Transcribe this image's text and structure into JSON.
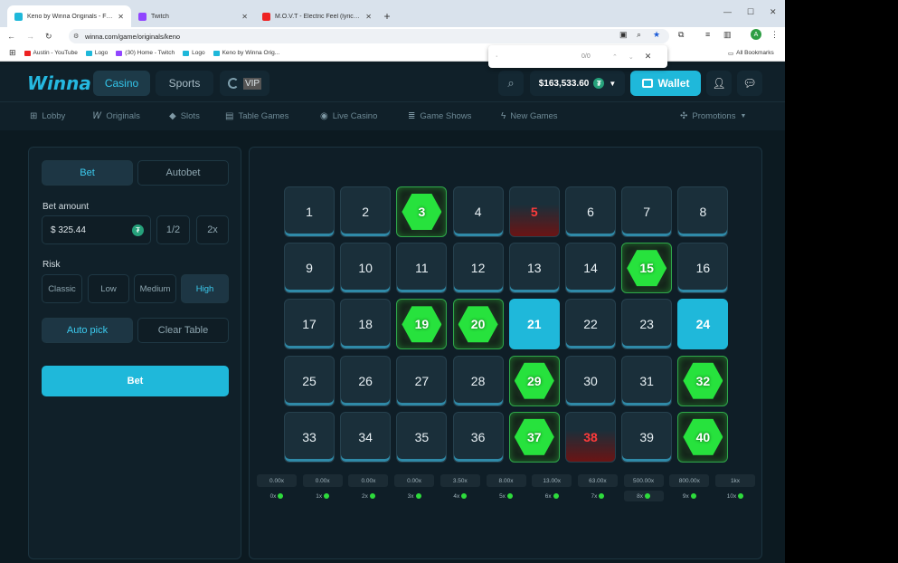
{
  "browser": {
    "tabs": [
      {
        "title": "Keno by Winna Originals - Fast",
        "color": "#1fb8da",
        "active": true
      },
      {
        "title": "Twitch",
        "color": "#9146ff",
        "active": false
      },
      {
        "title": "M.O.V.T - Electric Feel (lyrics) · ",
        "color": "#e22",
        "active": false
      }
    ],
    "url": "winna.com/game/originals/keno",
    "bookmarks": [
      "Austin - YouTube",
      "Logo",
      "(30) Home - Twitch",
      "Logo",
      "Keno by Winna Orig..."
    ],
    "all_bookmarks": "All Bookmarks",
    "find": {
      "value": "·",
      "count": "0/0"
    },
    "profile": "A"
  },
  "header": {
    "logo": "Winna",
    "casino": "Casino",
    "sports": "Sports",
    "vip": "VIP",
    "balance": "$163,533.60",
    "wallet": "Wallet"
  },
  "nav": {
    "items": [
      {
        "label": "Lobby",
        "icon": "grid-icon"
      },
      {
        "label": "Originals",
        "icon": "winna-w-icon"
      },
      {
        "label": "Slots",
        "icon": "diamond-icon"
      },
      {
        "label": "Table Games",
        "icon": "cards-icon"
      },
      {
        "label": "Live Casino",
        "icon": "live-signal-icon"
      },
      {
        "label": "Game Shows",
        "icon": "stack-icon"
      },
      {
        "label": "New Games",
        "icon": "lightning-icon"
      }
    ],
    "promotions": "Promotions"
  },
  "panel": {
    "tab_bet": "Bet",
    "tab_autobet": "Autobet",
    "bet_amount_label": "Bet amount",
    "bet_amount": "$  325.44",
    "half": "1/2",
    "double": "2x",
    "risk_label": "Risk",
    "risks": [
      "Classic",
      "Low",
      "Medium",
      "High"
    ],
    "selected_risk": "High",
    "auto_pick": "Auto pick",
    "clear_table": "Clear Table",
    "bet_button": "Bet"
  },
  "board": {
    "hits": [
      3,
      15,
      19,
      20,
      29,
      32,
      37,
      40
    ],
    "misses": [
      5,
      38
    ],
    "selected": [
      21,
      24
    ],
    "payouts": [
      "0.00x",
      "0.00x",
      "0.00x",
      "0.00x",
      "3.50x",
      "8.00x",
      "13.00x",
      "63.00x",
      "500.00x",
      "800.00x",
      "1kx"
    ],
    "hit_labels": [
      "0x",
      "1x",
      "2x",
      "3x",
      "4x",
      "5x",
      "6x",
      "7x",
      "8x",
      "9x",
      "10x"
    ],
    "current_hit_index": 8
  },
  "colors": {
    "accent": "#1fb8da",
    "hit_green": "#27e23d",
    "miss_red": "#ff3b3b",
    "bg": "#0f1e26"
  }
}
